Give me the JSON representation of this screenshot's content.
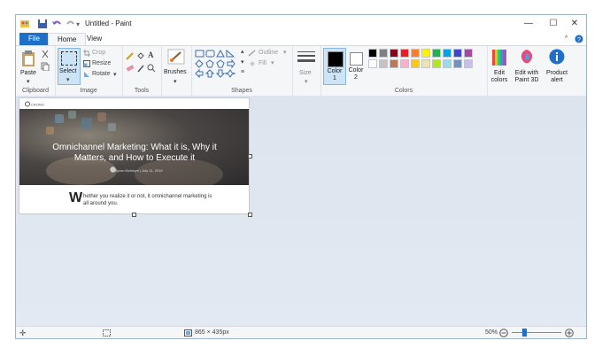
{
  "window": {
    "title": "Untitled - Paint"
  },
  "tabs": [
    {
      "label": "File"
    },
    {
      "label": "Home"
    },
    {
      "label": "View"
    }
  ],
  "ribbon": {
    "clipboard": {
      "paste": "Paste",
      "group": "Clipboard"
    },
    "image": {
      "select": "Select",
      "crop": "Crop",
      "resize": "Resize",
      "rotate": "Rotate",
      "group": "Image"
    },
    "tools": {
      "pencil_letter": "A",
      "group": "Tools"
    },
    "brushes": {
      "label": "Brushes"
    },
    "shapes": {
      "outline": "Outline",
      "fill": "Fill",
      "group": "Shapes"
    },
    "size": {
      "label": "Size"
    },
    "colors": {
      "color1": "Color 1",
      "color2": "Color 2",
      "edit": "Edit colors",
      "group": "Colors",
      "row1": [
        "#000000",
        "#7f7f7f",
        "#880015",
        "#ed1c24",
        "#ff7f27",
        "#fff200",
        "#22b14c",
        "#00a2e8",
        "#3f48cc",
        "#a349a4"
      ],
      "row2": [
        "#ffffff",
        "#c3c3c3",
        "#b97a57",
        "#ffaec9",
        "#ffc90e",
        "#efe4b0",
        "#b5e61d",
        "#99d9ea",
        "#7092be",
        "#c8bfe7"
      ],
      "color1_value": "#000000",
      "color2_value": "#ffffff"
    },
    "edit3d": "Edit with Paint 3D",
    "alert": "Product alert"
  },
  "image_content": {
    "logo": "CRONO",
    "hero_title": "Omnichannel Marketing: What it is, Why it Matters, and How to Execute it",
    "author": "Byron McIntyre | July 11, 2019",
    "dropcap": "W",
    "paragraph": "hether you realize it or not, it omnichannel marketing is all around you."
  },
  "status": {
    "dimensions": "865 × 435px",
    "zoom": "50%"
  }
}
